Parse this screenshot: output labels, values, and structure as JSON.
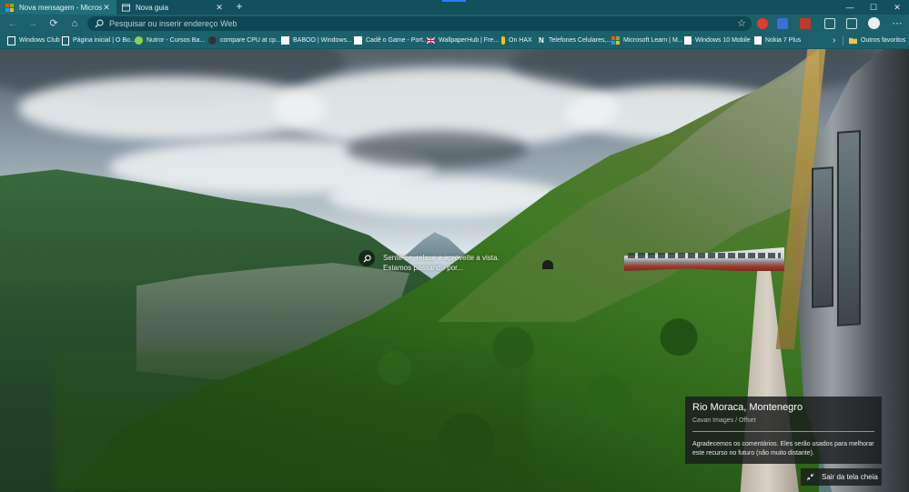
{
  "tabs": [
    {
      "label": "Nova mensagem - Microsoft Teams",
      "icon": "windows-logo-icon",
      "active": true,
      "close": "✕"
    },
    {
      "label": "Nova guia",
      "icon": "new-tab-page-icon",
      "active": false,
      "close": "✕"
    }
  ],
  "tabbar": {
    "new_tab": "+",
    "minimize": "—",
    "maximize": "☐",
    "close": "✕"
  },
  "nav": {
    "back": "←",
    "forward": "→",
    "refresh": "⟳",
    "home": "⌂",
    "address_placeholder": "Pesquisar ou inserir endereço Web",
    "favorite_star": "☆",
    "menu": "⋯"
  },
  "favorites": [
    {
      "label": "Windows Club",
      "icon": "bookmark-icon",
      "color": "#ffffff"
    },
    {
      "label": "Página inicial | O Bo...",
      "icon": "page-icon",
      "color": "#ffffff"
    },
    {
      "label": "Nutror - Cursos Ba...",
      "icon": "nutror-icon",
      "color": "#8fd14f"
    },
    {
      "label": "compare CPU at cp...",
      "icon": "cpu-icon",
      "color": "#333333"
    },
    {
      "label": "BABOO | Windows...",
      "icon": "baboo-icon",
      "color": "#ffffff"
    },
    {
      "label": "Cadê o Game - Port...",
      "icon": "game-icon",
      "color": "#ffffff"
    },
    {
      "label": "WallpaperHub | Fre...",
      "icon": "uk-flag-icon",
      "color": "#c8102e"
    },
    {
      "label": "On HAX",
      "icon": "hax-icon",
      "color": "#f5c400"
    },
    {
      "label": "Telefones Celulares,...",
      "icon": "n-icon",
      "color": "#ffffff"
    },
    {
      "label": "Microsoft Learn | M...",
      "icon": "microsoft-logo-icon",
      "color": "#f25022"
    },
    {
      "label": "Windows 10 Mobile",
      "icon": "page-icon",
      "color": "#ffffff"
    },
    {
      "label": "Nokia 7 Plus",
      "icon": "page-icon",
      "color": "#ffffff"
    }
  ],
  "favorites_more": "›",
  "other_favorites": "Outros favoritos",
  "center": {
    "line1": "Sente-se, relaxe e aproveite a vista.",
    "line2": "Estamos passando por..."
  },
  "info": {
    "title": "Rio Moraca, Montenegro",
    "credit": "Cavan Images / Offset",
    "message": "Agradecemos os comentários. Eles serão usados para melhorar este recurso no futuro (não muito distante)."
  },
  "exit_fullscreen": "Sair da tela cheia",
  "colors": {
    "tabbar": "#12505b",
    "toolbar": "#1b616c",
    "accent": "#2b7bff"
  }
}
